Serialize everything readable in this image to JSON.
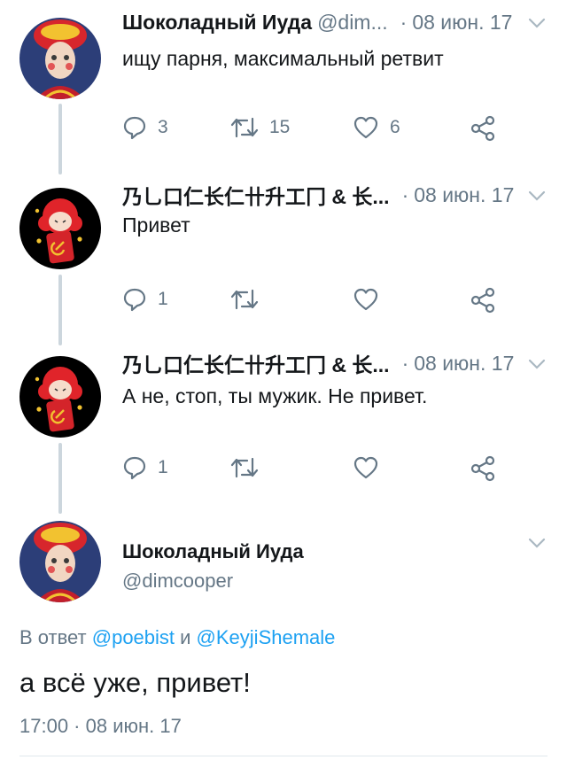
{
  "tweets": [
    {
      "name": "Шоколадный Иуда",
      "handle": "@dim...",
      "sep": "·",
      "date": "08 июн. 17",
      "text": "ищу парня, максимальный ретвит",
      "reply_count": "3",
      "retweet_count": "15",
      "like_count": "6"
    },
    {
      "name": "乃乚口仁长仁卄升工冂 & 长...",
      "sep": "·",
      "date": "08 июн. 17",
      "text": "Привет",
      "reply_count": "1"
    },
    {
      "name": "乃乚口仁长仁卄升工冂 & 长...",
      "sep": "·",
      "date": "08 июн. 17",
      "text": "А не, стоп, ты мужик. Не привет.",
      "reply_count": "1"
    }
  ],
  "main_tweet": {
    "name": "Шоколадный Иуда",
    "handle": "@dimcooper",
    "reply_prefix": "В ответ ",
    "reply_user1": "@poebist",
    "reply_joiner": " и ",
    "reply_user2": "@KeyjiShemale",
    "text": "а всё уже, привет!",
    "timestamp": "17:00 · 08 июн. 17"
  },
  "colors": {
    "accent": "#1da1f2",
    "muted": "#657786",
    "thread_line": "#ccd6dd"
  }
}
